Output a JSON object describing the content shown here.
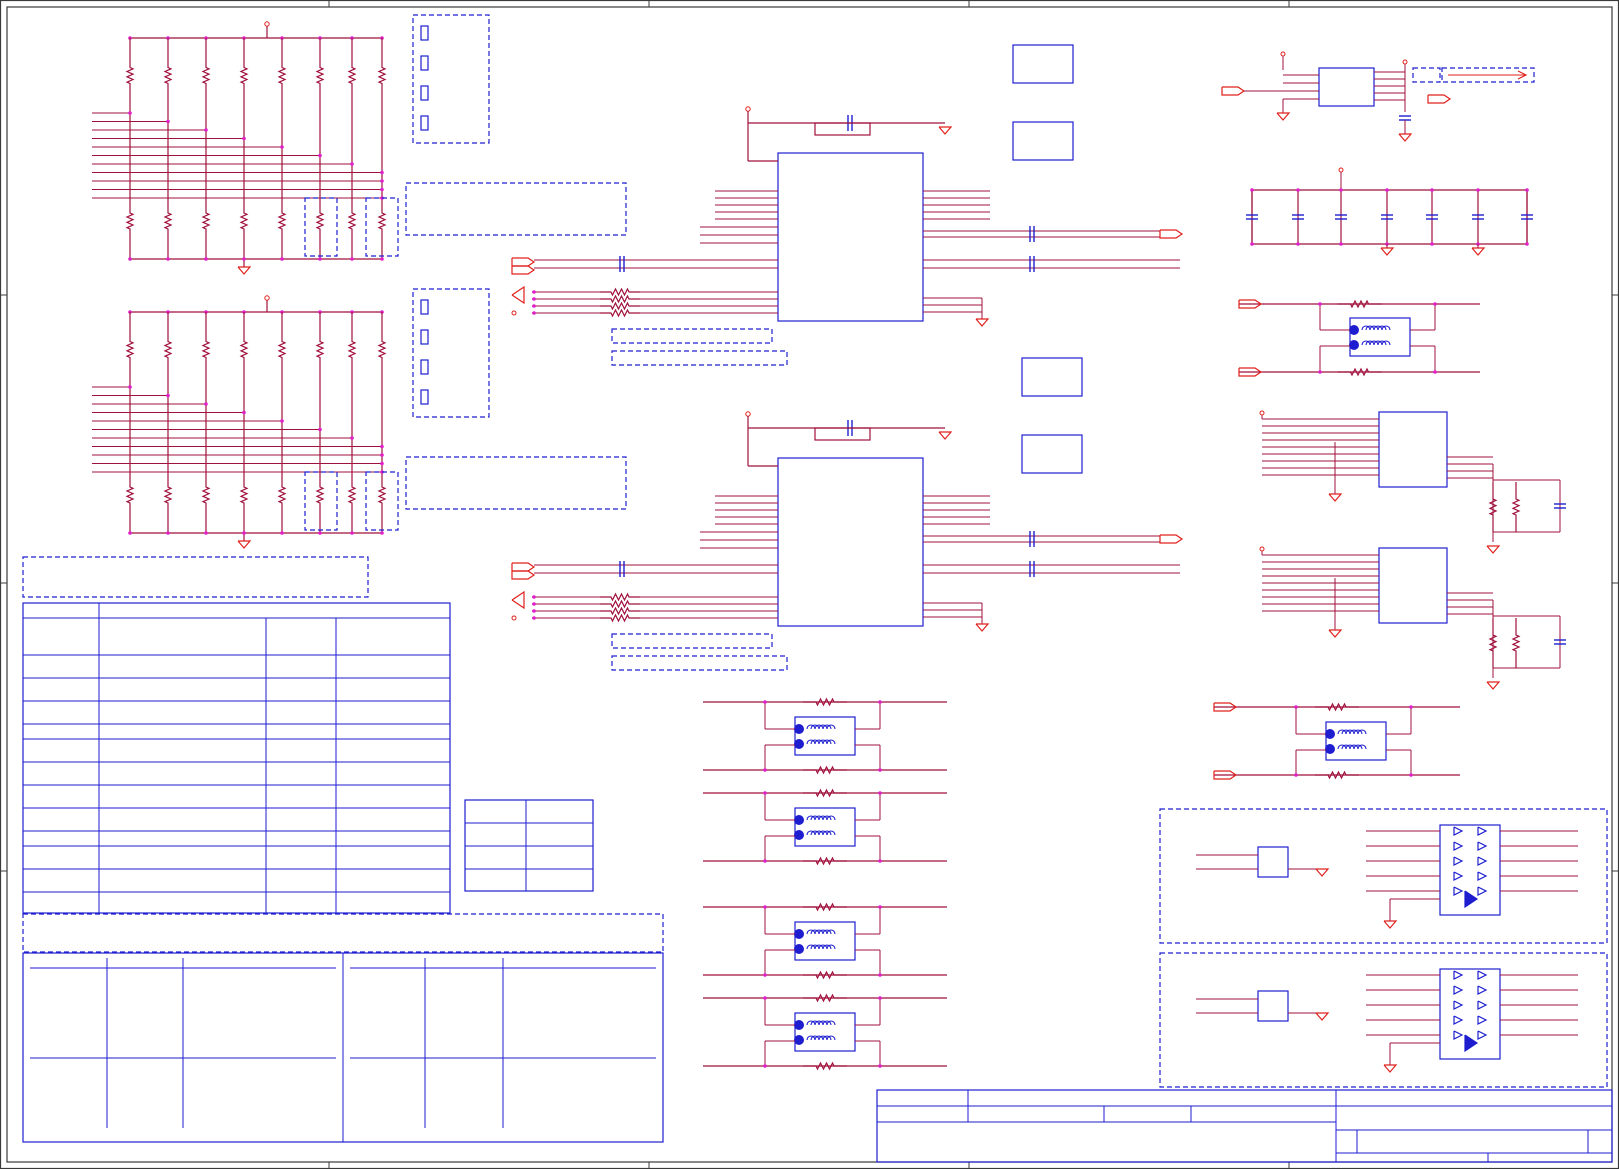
{
  "schematic": {
    "colors": {
      "wire": "#a0103c",
      "signal": "#e0201c",
      "part": "#1e1ed0",
      "junction": "#e020c8",
      "frame": "#3a3a3a",
      "dot": "#1e1ed0"
    },
    "frame_labels": {},
    "title_block": {}
  }
}
